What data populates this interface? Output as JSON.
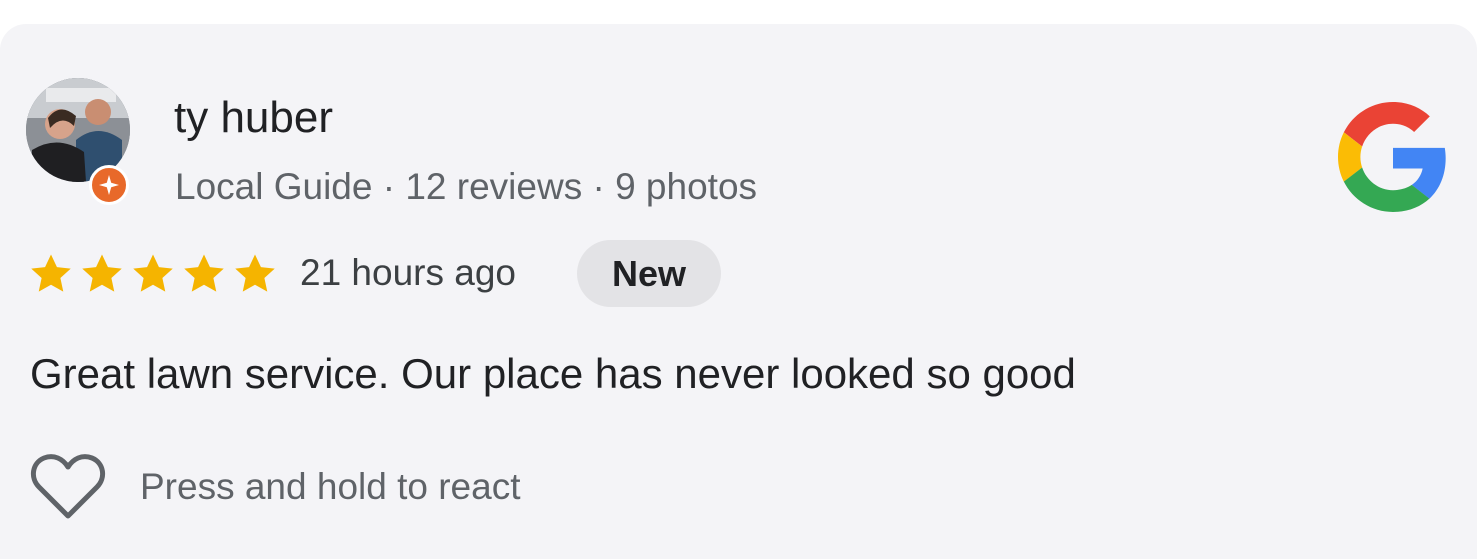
{
  "review": {
    "reviewer_name": "ty huber",
    "reviewer_meta": "Local Guide · 12 reviews · 9 photos",
    "rating": 5,
    "rating_max": 5,
    "time_ago": "21 hours ago",
    "new_label": "New",
    "text": "Great lawn service. Our place has never looked so good"
  },
  "react": {
    "hint": "Press and hold to react"
  },
  "icons": {
    "avatar": "profile-photo",
    "badge": "local-guide-badge-icon",
    "logo": "google-g-logo",
    "star": "star-icon",
    "react": "heart-icon"
  },
  "colors": {
    "card_bg": "#f4f4f7",
    "star": "#f5b400",
    "badge": "#e8692a",
    "new_badge_bg": "#e3e3e6",
    "google_blue": "#4285F4",
    "google_red": "#EA4335",
    "google_yellow": "#FBBC05",
    "google_green": "#34A853"
  }
}
